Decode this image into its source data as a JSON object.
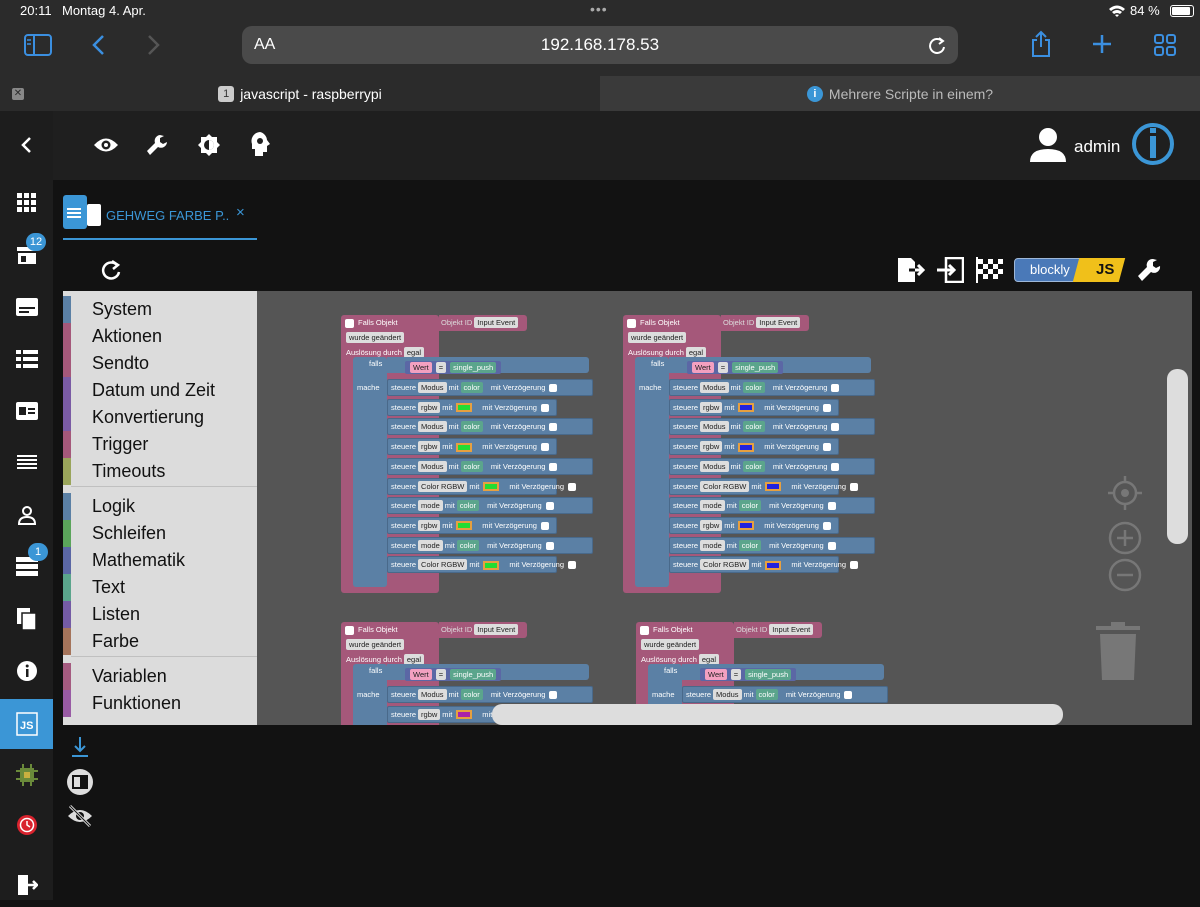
{
  "status": {
    "time": "20:11",
    "date": "Montag 4. Apr.",
    "battery": "84 %"
  },
  "browser": {
    "aa_label": "AA",
    "url": "192.168.178.53"
  },
  "tabs": [
    {
      "num": "1",
      "label": "javascript - raspberrypi"
    },
    {
      "label": "Mehrere Scripte in einem?"
    }
  ],
  "nav": {
    "badge_objects": "12",
    "badge_instances": "1"
  },
  "user": {
    "name": "admin"
  },
  "script_tab": {
    "title": "GEHWEG FARBE P..",
    "close": "×"
  },
  "toolbar": {
    "blockly_label": "blockly",
    "js_label": "JS"
  },
  "toolbox": {
    "group1": [
      "System",
      "Aktionen",
      "Sendto",
      "Datum und Zeit",
      "Konvertierung",
      "Trigger",
      "Timeouts"
    ],
    "group2": [
      "Logik",
      "Schleifen",
      "Mathematik",
      "Text",
      "Listen",
      "Farbe"
    ],
    "group3": [
      "Variablen",
      "Funktionen"
    ]
  },
  "colors": {
    "accent": "#3b96d6",
    "event_block": "#a5587a",
    "control_block": "#5b80a5",
    "green_swatch": "#22dd33",
    "blue_swatch": "#2222dd",
    "purple_swatch": "#aa22aa"
  },
  "blocks": {
    "falls_objekt": "Falls Objekt",
    "objekt_id": "Objekt ID",
    "input_event": "Input Event",
    "wurde_geaendert": "wurde geändert",
    "ausloesung_durch": "Auslösung durch",
    "egal": "egal",
    "falls": "falls",
    "mache": "mache",
    "wert": "Wert",
    "eq": "=",
    "single_push": "single_push",
    "steuere": "steuere",
    "mit": "mit",
    "mit_verzoegerung": "mit Verzögerung",
    "color": "color",
    "rows": [
      "Modus",
      "rgbw",
      "Modus",
      "rgbw",
      "Modus",
      "Color RGBW",
      "mode",
      "rgbw",
      "mode",
      "Color RGBW"
    ]
  }
}
